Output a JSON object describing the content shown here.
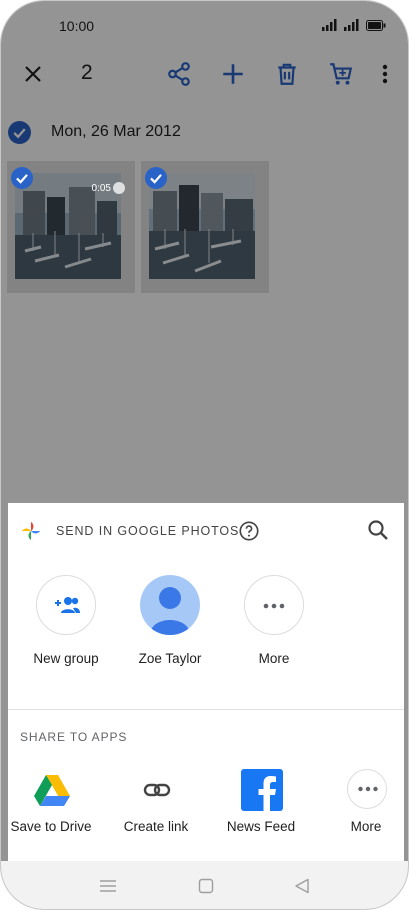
{
  "status_bar": {
    "time": "10:00"
  },
  "toolbar": {
    "selected_count": "2"
  },
  "gallery": {
    "date_header": "Mon, 26 Mar 2012",
    "items": [
      {
        "type": "video",
        "duration": "0:05",
        "selected": true
      },
      {
        "type": "photo",
        "selected": true
      }
    ]
  },
  "share_sheet": {
    "title": "SEND IN GOOGLE PHOTOS",
    "contacts": [
      {
        "label": "New group",
        "icon": "add-group-icon"
      },
      {
        "label": "Zoe Taylor",
        "icon": "person-avatar"
      },
      {
        "label": "More",
        "icon": "more-horiz-icon"
      }
    ],
    "apps_title": "SHARE TO APPS",
    "apps": [
      {
        "label": "Save to Drive",
        "icon": "google-drive-icon"
      },
      {
        "label": "Create link",
        "icon": "link-icon"
      },
      {
        "label": "News Feed",
        "icon": "facebook-icon"
      },
      {
        "label": "More",
        "icon": "more-horiz-icon"
      }
    ]
  },
  "colors": {
    "accent_blue": "#2a63c8",
    "facebook_blue": "#1877f2",
    "avatar_bg": "#a6c8f7",
    "avatar_fg": "#3b78e7"
  }
}
